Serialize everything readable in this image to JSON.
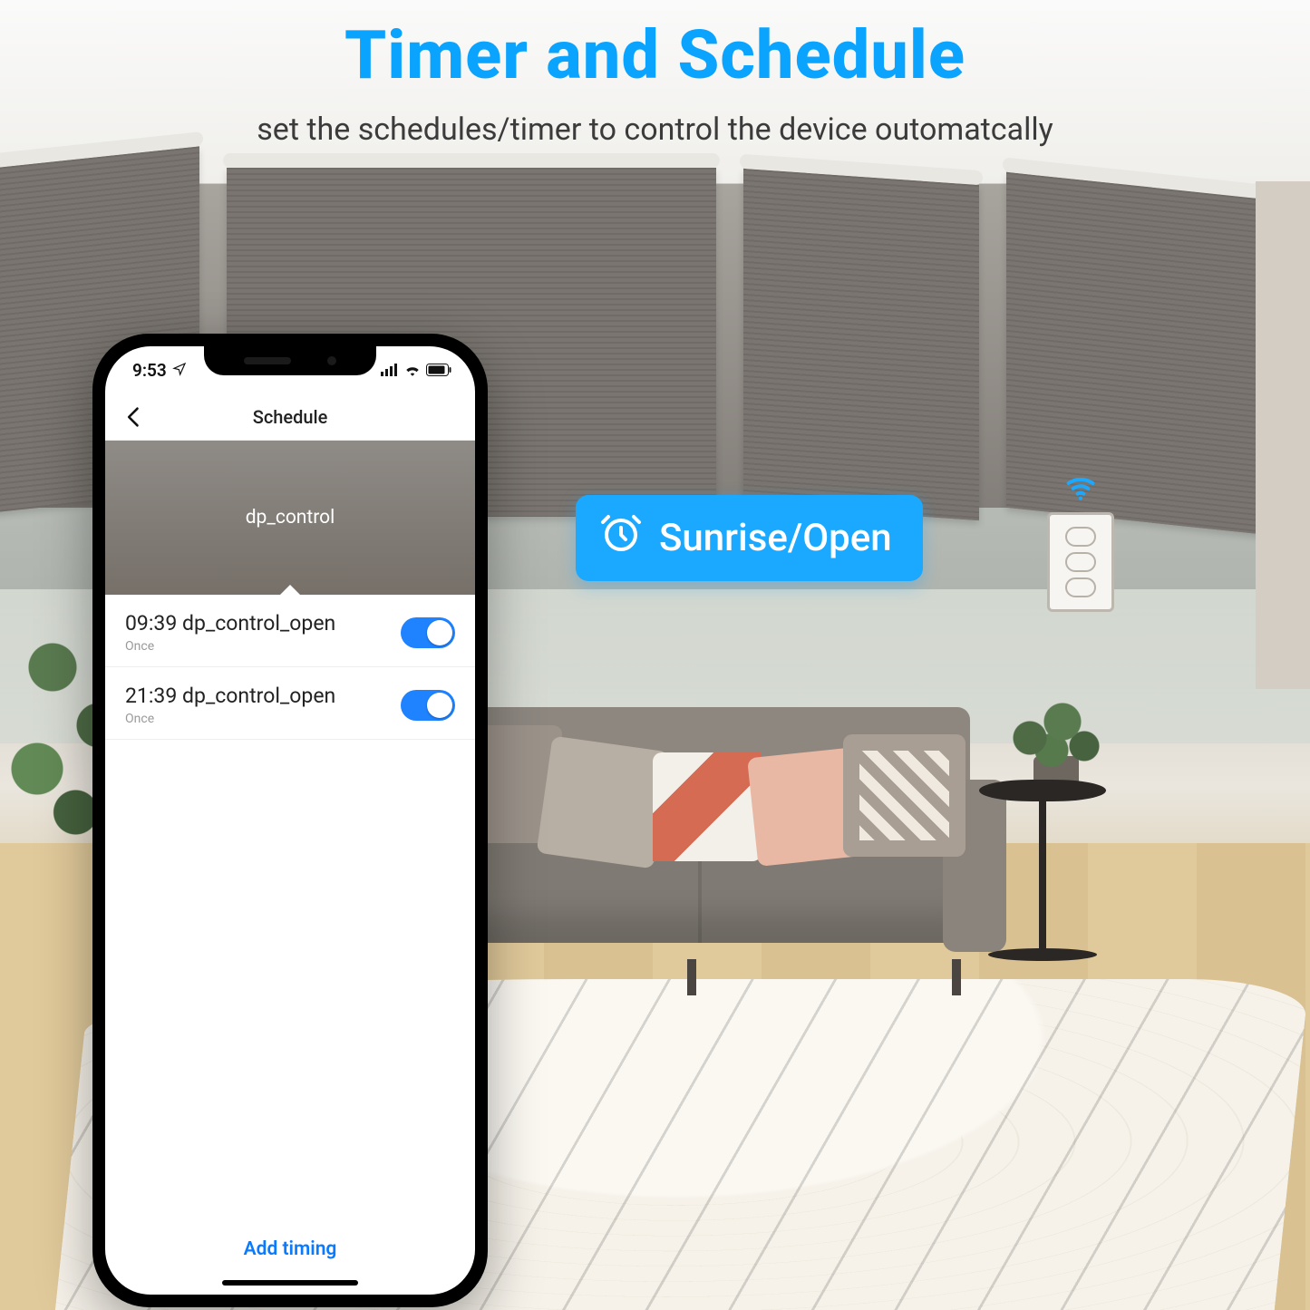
{
  "hero": {
    "title": "Timer and Schedule",
    "subtitle": "set the schedules/timer to control the device outomatcally"
  },
  "callout": {
    "icon": "alarm-clock-icon",
    "label": "Sunrise/Open"
  },
  "phone": {
    "status": {
      "time": "9:53",
      "location_icon": "location-arrow-icon",
      "signal_icon": "cellular-signal-icon",
      "wifi_icon": "wifi-icon",
      "battery_icon": "battery-icon"
    },
    "nav": {
      "back_icon": "chevron-left-icon",
      "title": "Schedule"
    },
    "banner": {
      "label": "dp_control"
    },
    "schedules": [
      {
        "time": "09:39",
        "name": "dp_control_open",
        "repeat": "Once",
        "enabled": true
      },
      {
        "time": "21:39",
        "name": "dp_control_open",
        "repeat": "Once",
        "enabled": true
      }
    ],
    "add_button": "Add timing"
  },
  "wall_switch": {
    "wifi_icon": "wifi-icon"
  },
  "colors": {
    "accent": "#1aa9ff",
    "ios_blue": "#0a7aff"
  }
}
